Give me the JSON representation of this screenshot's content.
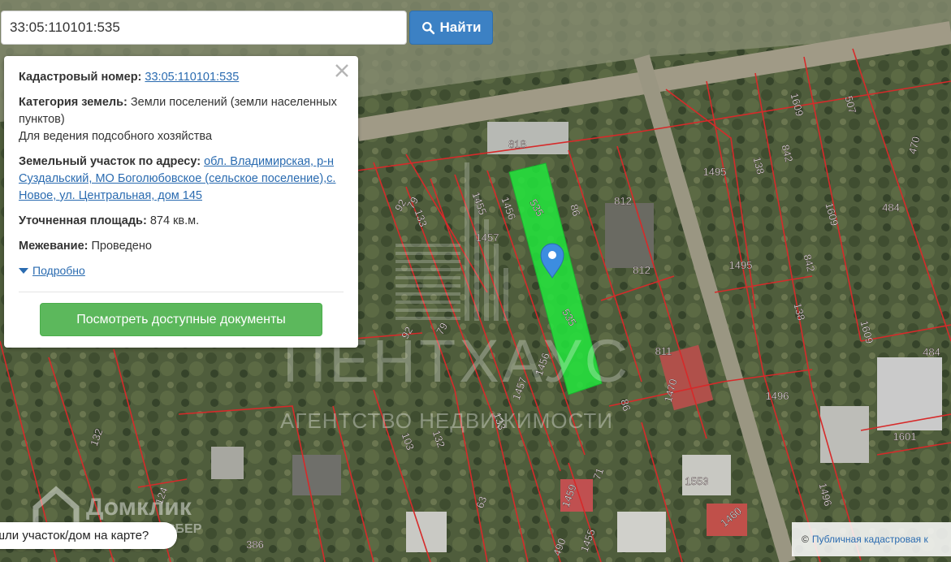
{
  "search": {
    "value": "33:05:110101:535",
    "button_label": "Найти"
  },
  "info": {
    "cadastral_label": "Кадастровый номер:",
    "cadastral_value": "33:05:110101:535",
    "category_label": "Категория земель:",
    "category_value": "Земли поселений (земли населенных пунктов)",
    "usage": "Для ведения подсобного хозяйства",
    "address_label": "Земельный участок по адресу:",
    "address_value": "обл. Владимирская, р-н Суздальский, МО Боголюбовское (сельское поселение),с. Новое, ул. Центральная, дом 145",
    "area_label": "Уточненная площадь:",
    "area_value": "874 кв.м.",
    "survey_label": "Межевание:",
    "survey_value": "Проведено",
    "details_label": "Подробно",
    "docs_button_label": "Посмотреть доступные документы"
  },
  "map": {
    "parcel_labels": [
      "818",
      "86",
      "812",
      "812",
      "811",
      "1470",
      "86",
      "1495",
      "1495",
      "1496",
      "138",
      "138",
      "842",
      "842",
      "1609",
      "1609",
      "1609",
      "507",
      "470",
      "484",
      "484",
      "1601",
      "1496",
      "1460",
      "1553",
      "1459",
      "1455",
      "71",
      "63",
      "124",
      "132",
      "132",
      "103",
      "133",
      "133",
      "1457",
      "1457",
      "1456",
      "1456",
      "1455",
      "92",
      "92",
      "79",
      "79",
      "535",
      "535",
      "490",
      "386"
    ],
    "watermark_main": "ПЕНТХАУС",
    "watermark_sub": "АГЕНТСТВО НЕДВИЖИМОСТИ",
    "brand_name": "Домклик",
    "brand_sub": "СБЕР"
  },
  "found_prompt": "шли участок/дом на карте?",
  "attribution": {
    "symbol": "©",
    "link": "Публичная кадастровая к"
  },
  "colors": {
    "selected_parcel": "#22e63c",
    "parcel_border": "#d62a2a",
    "marker": "#3c8de0",
    "search_button": "#3c81c4",
    "docs_button": "#5cb85c"
  }
}
